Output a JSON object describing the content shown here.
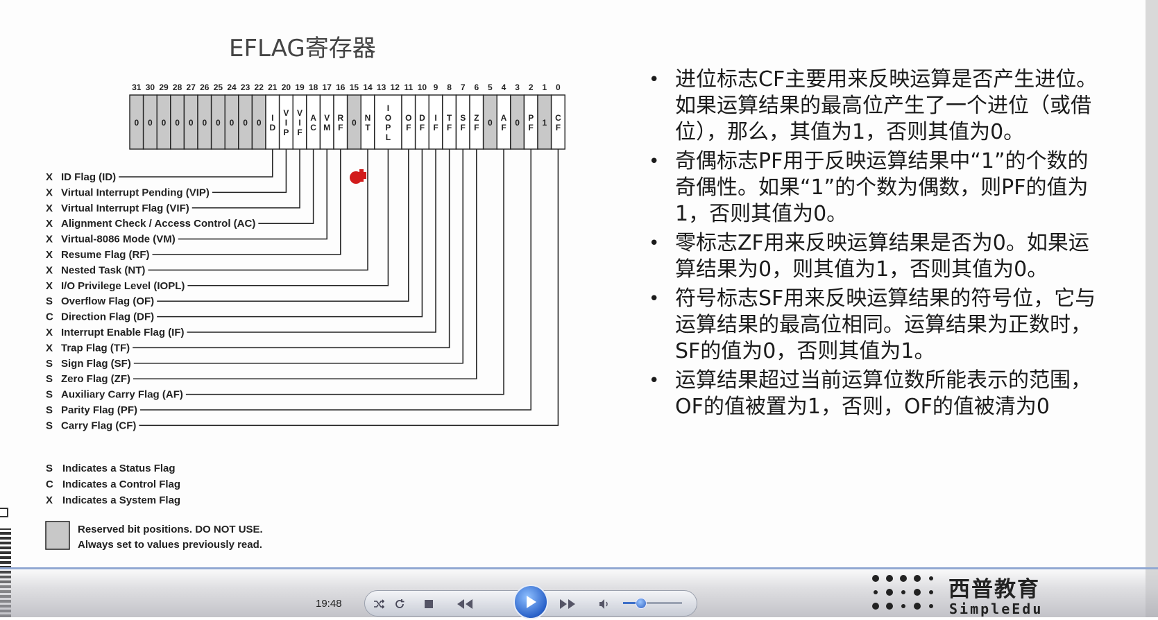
{
  "slide": {
    "title": "EFLAG寄存器",
    "register": {
      "bit_numbers": [
        "31",
        "30",
        "29",
        "28",
        "27",
        "26",
        "25",
        "24",
        "23",
        "22",
        "21",
        "20",
        "19",
        "18",
        "17",
        "16",
        "15",
        "14",
        "13",
        "12",
        "11",
        "10",
        "9",
        "8",
        "7",
        "6",
        "5",
        "4",
        "3",
        "2",
        "1",
        "0"
      ],
      "cells": [
        {
          "bits": [
            31,
            31
          ],
          "label": "0",
          "shaded": true
        },
        {
          "bits": [
            30,
            30
          ],
          "label": "0",
          "shaded": true
        },
        {
          "bits": [
            29,
            29
          ],
          "label": "0",
          "shaded": true
        },
        {
          "bits": [
            28,
            28
          ],
          "label": "0",
          "shaded": true
        },
        {
          "bits": [
            27,
            27
          ],
          "label": "0",
          "shaded": true
        },
        {
          "bits": [
            26,
            26
          ],
          "label": "0",
          "shaded": true
        },
        {
          "bits": [
            25,
            25
          ],
          "label": "0",
          "shaded": true
        },
        {
          "bits": [
            24,
            24
          ],
          "label": "0",
          "shaded": true
        },
        {
          "bits": [
            23,
            23
          ],
          "label": "0",
          "shaded": true
        },
        {
          "bits": [
            22,
            22
          ],
          "label": "0",
          "shaded": true
        },
        {
          "bits": [
            21,
            21
          ],
          "label": "I\nD",
          "shaded": false
        },
        {
          "bits": [
            20,
            20
          ],
          "label": "V\nI\nP",
          "shaded": false
        },
        {
          "bits": [
            19,
            19
          ],
          "label": "V\nI\nF",
          "shaded": false
        },
        {
          "bits": [
            18,
            18
          ],
          "label": "A\nC",
          "shaded": false
        },
        {
          "bits": [
            17,
            17
          ],
          "label": "V\nM",
          "shaded": false
        },
        {
          "bits": [
            16,
            16
          ],
          "label": "R\nF",
          "shaded": false
        },
        {
          "bits": [
            15,
            15
          ],
          "label": "0",
          "shaded": true
        },
        {
          "bits": [
            14,
            14
          ],
          "label": "N\nT",
          "shaded": false
        },
        {
          "bits": [
            13,
            12
          ],
          "label": "I\nO\nP\nL",
          "shaded": false
        },
        {
          "bits": [
            11,
            11
          ],
          "label": "O\nF",
          "shaded": false
        },
        {
          "bits": [
            10,
            10
          ],
          "label": "D\nF",
          "shaded": false
        },
        {
          "bits": [
            9,
            9
          ],
          "label": "I\nF",
          "shaded": false
        },
        {
          "bits": [
            8,
            8
          ],
          "label": "T\nF",
          "shaded": false
        },
        {
          "bits": [
            7,
            7
          ],
          "label": "S\nF",
          "shaded": false
        },
        {
          "bits": [
            6,
            6
          ],
          "label": "Z\nF",
          "shaded": false
        },
        {
          "bits": [
            5,
            5
          ],
          "label": "0",
          "shaded": true
        },
        {
          "bits": [
            4,
            4
          ],
          "label": "A\nF",
          "shaded": false
        },
        {
          "bits": [
            3,
            3
          ],
          "label": "0",
          "shaded": true
        },
        {
          "bits": [
            2,
            2
          ],
          "label": "P\nF",
          "shaded": false
        },
        {
          "bits": [
            1,
            1
          ],
          "label": "1",
          "shaded": true
        },
        {
          "bits": [
            0,
            0
          ],
          "label": "C\nF",
          "shaded": false
        }
      ]
    },
    "flags": [
      {
        "type": "X",
        "label": "ID Flag (ID)",
        "bit": 21
      },
      {
        "type": "X",
        "label": "Virtual Interrupt Pending (VIP)",
        "bit": 20
      },
      {
        "type": "X",
        "label": "Virtual Interrupt Flag (VIF)",
        "bit": 19
      },
      {
        "type": "X",
        "label": "Alignment Check / Access Control (AC)",
        "bit": 18
      },
      {
        "type": "X",
        "label": "Virtual-8086 Mode (VM)",
        "bit": 17
      },
      {
        "type": "X",
        "label": "Resume Flag (RF)",
        "bit": 16
      },
      {
        "type": "X",
        "label": "Nested Task (NT)",
        "bit": 14
      },
      {
        "type": "X",
        "label": "I/O Privilege Level (IOPL)",
        "bit": 12.5
      },
      {
        "type": "S",
        "label": "Overflow Flag (OF)",
        "bit": 11
      },
      {
        "type": "C",
        "label": "Direction Flag (DF)",
        "bit": 10
      },
      {
        "type": "X",
        "label": "Interrupt Enable Flag (IF)",
        "bit": 9
      },
      {
        "type": "X",
        "label": "Trap Flag (TF)",
        "bit": 8
      },
      {
        "type": "S",
        "label": "Sign Flag (SF)",
        "bit": 7
      },
      {
        "type": "S",
        "label": "Zero Flag (ZF)",
        "bit": 6
      },
      {
        "type": "S",
        "label": "Auxiliary Carry Flag (AF)",
        "bit": 4
      },
      {
        "type": "S",
        "label": "Parity Flag (PF)",
        "bit": 2
      },
      {
        "type": "S",
        "label": "Carry Flag (CF)",
        "bit": 0
      }
    ],
    "legend": [
      {
        "type": "S",
        "text": "Indicates a Status Flag"
      },
      {
        "type": "C",
        "text": "Indicates a Control Flag"
      },
      {
        "type": "X",
        "text": "Indicates a System Flag"
      }
    ],
    "reserved_note": [
      "Reserved bit positions. DO NOT USE.",
      "Always set to values previously read."
    ],
    "bullets": [
      "进位标志CF主要用来反映运算是否产生进位。如果运算结果的最高位产生了一个进位（或借位），那么，其值为1，否则其值为0。",
      "奇偶标志PF用于反映运算结果中“1”的个数的奇偶性。如果“1”的个数为偶数，则PF的值为1，否则其值为0。",
      "零标志ZF用来反映运算结果是否为0。如果运算结果为0，则其值为1，否则其值为0。",
      "符号标志SF用来反映运算结果的符号位，它与运算结果的最高位相同。运算结果为正数时，SF的值为0，否则其值为1。",
      "运算结果超过当前运算位数所能表示的范围，OF的值被置为1，否则，OF的值被清为0"
    ]
  },
  "player": {
    "time": "19:48",
    "icons": [
      "shuffle-icon",
      "loop-icon",
      "stop-icon",
      "rewind-icon",
      "play-icon",
      "fast-forward-icon",
      "volume-icon"
    ],
    "volume_level": 0.3
  },
  "brand": {
    "name_cn": "西普教育",
    "name_en": "SimpleEdu"
  },
  "colors": {
    "shaded_cell": "#c8c8c8",
    "line": "#222222",
    "cursor_marker": "#d21c1c",
    "play_button": "#2a62c9"
  }
}
